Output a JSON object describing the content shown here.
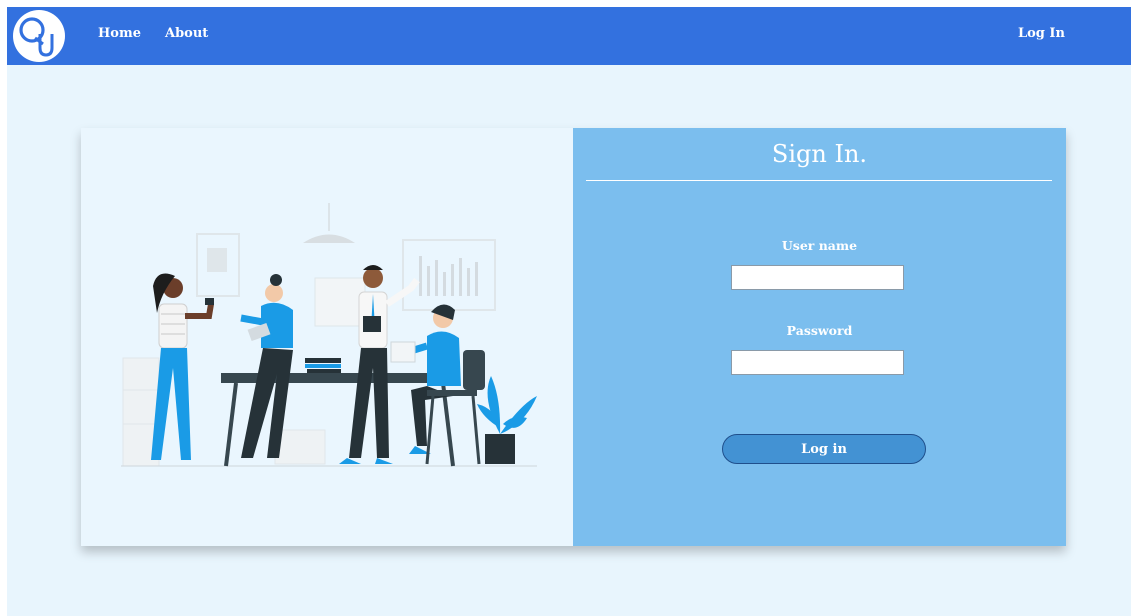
{
  "navbar": {
    "logo_letters": "QU",
    "links": [
      {
        "label": "Home"
      },
      {
        "label": "About"
      }
    ],
    "login_link": "Log In",
    "color": "#3371df"
  },
  "signin": {
    "title": "Sign In.",
    "username_label": "User name",
    "username_value": "",
    "password_label": "Password",
    "password_value": "",
    "submit_label": "Log in",
    "panel_color": "#7bbeee",
    "button_color": "#4392d3"
  },
  "illustration": {
    "name": "team-meeting-illustration",
    "accent": "#1a9be6",
    "dark": "#263238"
  }
}
